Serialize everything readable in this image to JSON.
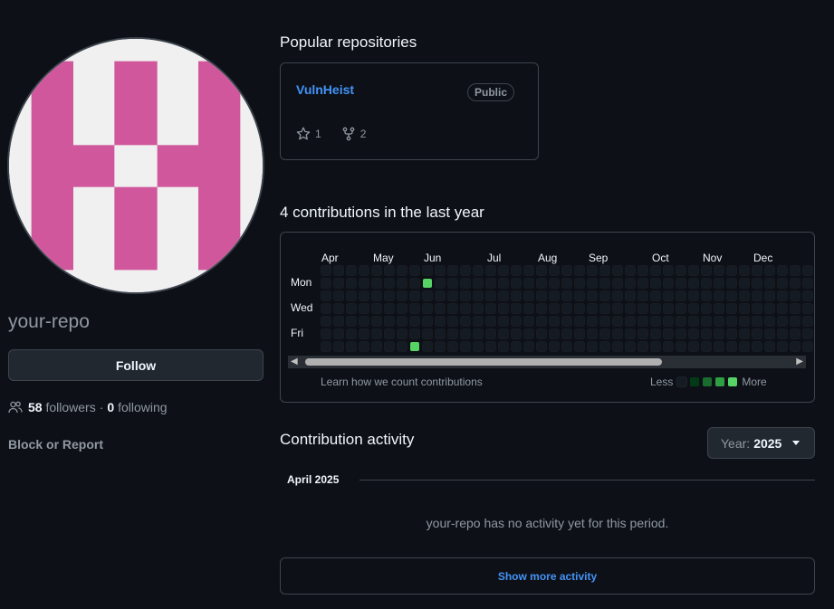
{
  "profile": {
    "login": "your-repo",
    "follow_label": "Follow",
    "followers_count": "58",
    "followers_label": "followers",
    "separator": "·",
    "following_count": "0",
    "following_label": "following",
    "block_report_label": "Block or Report",
    "avatar_colors": {
      "fg": "#d0579c",
      "bg": "#f0f0f0"
    }
  },
  "popular": {
    "title": "Popular repositories",
    "repos": [
      {
        "name": "VulnHeist",
        "visibility": "Public",
        "stars": "1",
        "forks": "2"
      }
    ]
  },
  "contributions": {
    "title": "4 contributions in the last year",
    "months": [
      "Apr",
      "May",
      "Jun",
      "Jul",
      "Aug",
      "Sep",
      "Oct",
      "Nov",
      "Dec"
    ],
    "day_labels": [
      "Mon",
      "Wed",
      "Fri"
    ],
    "learn_label": "Learn how we count contributions",
    "legend_less": "Less",
    "legend_more": "More",
    "legend_colors": [
      "#151b23",
      "#033a16",
      "#196c2e",
      "#2ea043",
      "#56d364"
    ]
  },
  "activity": {
    "title": "Contribution activity",
    "year_prefix": "Year:",
    "year_value": "2025",
    "month_heading": "April 2025",
    "no_activity_text": "your-repo has no activity yet for this period.",
    "show_more_label": "Show more activity"
  }
}
